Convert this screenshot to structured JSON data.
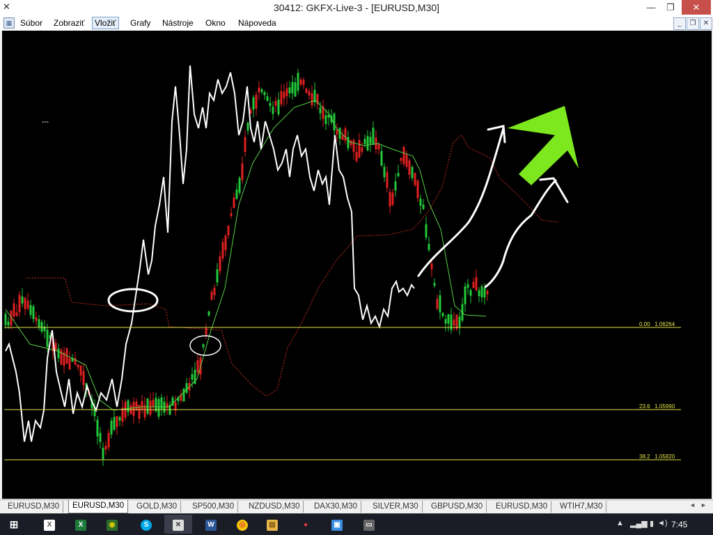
{
  "window": {
    "title": "30412: GKFX-Live-3 - [EURUSD,M30]",
    "minimize": "—",
    "maximize": "❐",
    "close": "✕"
  },
  "menu": {
    "items": [
      "Súbor",
      "Zobraziť",
      "Vložiť",
      "Grafy",
      "Nástroje",
      "Okno",
      "Nápoveda"
    ],
    "active": "Vložiť"
  },
  "chart": {
    "symbol": "EURUSD",
    "timeframe": "M30",
    "background": "#000000",
    "bull_color": "#22c93a",
    "bear_color": "#e02020",
    "cloud_color": "#d03020",
    "fib_color": "#e6e64a",
    "arrow_color": "#7ee81e",
    "marker": "---",
    "fib_levels": [
      {
        "level": "0.00",
        "price": "1.06264"
      },
      {
        "level": "23.6",
        "price": "1.05990"
      },
      {
        "level": "38.2",
        "price": "1.05820"
      }
    ]
  },
  "tabs": {
    "items": [
      "EURUSD,M30",
      "EURUSD,M30",
      "GOLD,M30",
      "SP500,M30",
      "NZDUSD,M30",
      "DAX30,M30",
      "SILVER,M30",
      "GBPUSD,M30",
      "EURUSD,M30",
      "WTIH7,M30"
    ],
    "active_index": 1
  },
  "taskbar": {
    "apps": [
      {
        "name": "start-icon",
        "glyph": "⊞",
        "color": "#ffffff"
      },
      {
        "name": "excel-icon",
        "glyph": "X",
        "color": "#1d7a3a"
      },
      {
        "name": "excel-icon",
        "glyph": "X",
        "color": "#1d7a3a"
      },
      {
        "name": "chart-app-icon",
        "glyph": "◉",
        "color": "#c9b500"
      },
      {
        "name": "skype-icon",
        "glyph": "S",
        "color": "#00a8e8"
      },
      {
        "name": "metatrader-icon",
        "glyph": "✕",
        "color": "#cccccc"
      },
      {
        "name": "word-icon",
        "glyph": "W",
        "color": "#2b5797"
      },
      {
        "name": "chrome-icon",
        "glyph": "◎",
        "color": "#dd4b39"
      },
      {
        "name": "file-explorer-icon",
        "glyph": "▤",
        "color": "#e8b54a"
      },
      {
        "name": "dots-app-icon",
        "glyph": "●",
        "color": "#e03a3a"
      },
      {
        "name": "image-app-icon",
        "glyph": "▣",
        "color": "#3a8de0"
      },
      {
        "name": "monitor-icon",
        "glyph": "▭",
        "color": "#cccccc"
      }
    ],
    "clock": "7:45"
  }
}
